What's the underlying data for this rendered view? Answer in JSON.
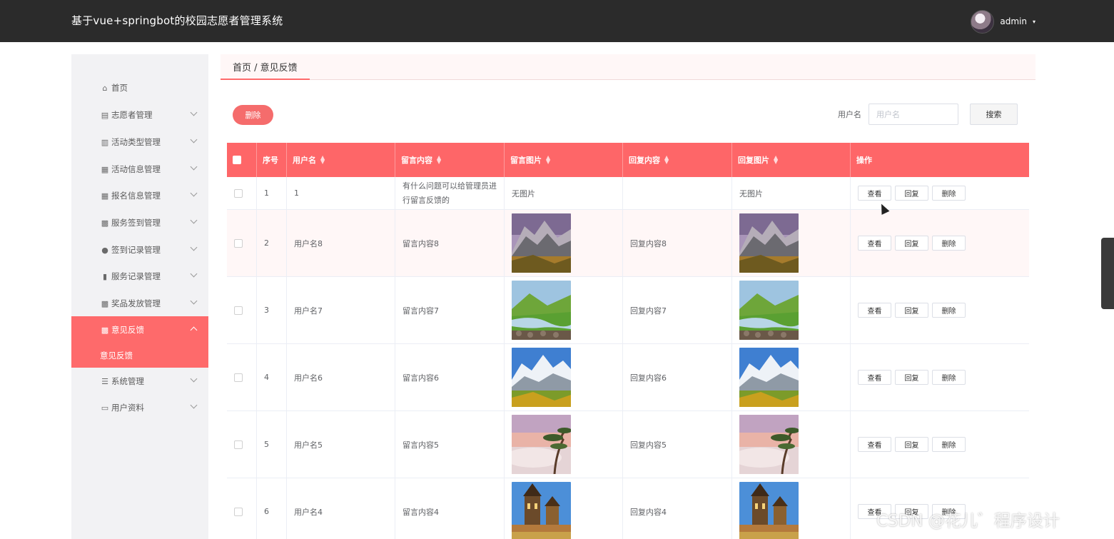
{
  "header": {
    "title": "基于vue+springbot的校园志愿者管理系统",
    "user_name": "admin",
    "caret": "▾"
  },
  "sidebar": {
    "items": [
      {
        "label": "首页",
        "icon": "home-icon",
        "glyph": "⌂"
      },
      {
        "label": "志愿者管理",
        "icon": "chart-icon",
        "glyph": "▤"
      },
      {
        "label": "活动类型管理",
        "icon": "bars-icon",
        "glyph": "▥"
      },
      {
        "label": "活动信息管理",
        "icon": "doc-icon",
        "glyph": "▦"
      },
      {
        "label": "报名信息管理",
        "icon": "doc-icon",
        "glyph": "▦"
      },
      {
        "label": "服务签到管理",
        "icon": "grid-icon",
        "glyph": "▩"
      },
      {
        "label": "签到记录管理",
        "icon": "user-icon",
        "glyph": "●"
      },
      {
        "label": "服务记录管理",
        "icon": "bar-chart-icon",
        "glyph": "▮"
      },
      {
        "label": "奖品发放管理",
        "icon": "grid-icon",
        "glyph": "▩"
      },
      {
        "label": "意见反馈",
        "icon": "grid-icon",
        "glyph": "▩",
        "active": true
      },
      {
        "label": "系统管理",
        "icon": "list-icon",
        "glyph": "☰"
      },
      {
        "label": "用户资料",
        "icon": "card-icon",
        "glyph": "▭"
      }
    ],
    "sub_item": "意见反馈"
  },
  "breadcrumb": "首页 / 意见反馈",
  "toolbar": {
    "delete_label": "删除",
    "search_label": "用户名",
    "search_placeholder": "用户名",
    "search_button": "搜索"
  },
  "table": {
    "headers": [
      "序号",
      "用户名",
      "留言内容",
      "留言图片",
      "回复内容",
      "回复图片",
      "操作"
    ],
    "actions": [
      "查看",
      "回复",
      "删除"
    ],
    "rows": [
      {
        "index": "1",
        "user": "1",
        "content": "有什么问题可以给管理员进行留言反馈的",
        "image": "无图片",
        "reply": "",
        "reply_image": "无图片"
      },
      {
        "index": "2",
        "user": "用户名8",
        "content": "留言内容8",
        "image": "mountain-valley",
        "reply": "回复内容8",
        "reply_image": "mountain-valley"
      },
      {
        "index": "3",
        "user": "用户名7",
        "content": "留言内容7",
        "image": "green-river",
        "reply": "回复内容7",
        "reply_image": "green-river"
      },
      {
        "index": "4",
        "user": "用户名6",
        "content": "留言内容6",
        "image": "snow-peak",
        "reply": "回复内容6",
        "reply_image": "snow-peak"
      },
      {
        "index": "5",
        "user": "用户名5",
        "content": "留言内容5",
        "image": "misty-pine",
        "reply": "回复内容5",
        "reply_image": "misty-pine"
      },
      {
        "index": "6",
        "user": "用户名4",
        "content": "留言内容4",
        "image": "old-tower",
        "reply": "回复内容4",
        "reply_image": "old-tower"
      }
    ]
  },
  "watermark": "CSDN @花儿゛程序设计",
  "colors": {
    "accent": "#fe6a6b",
    "topbar": "#2b2b2b",
    "sidebar_bg": "#f2f2f4"
  }
}
